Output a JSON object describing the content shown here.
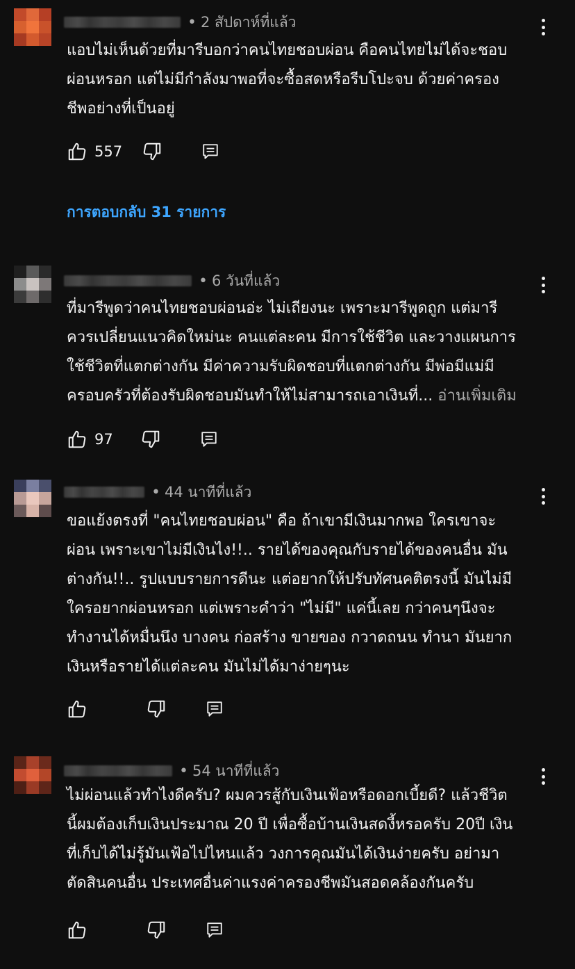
{
  "comments": [
    {
      "time": "2 สัปดาห์ที่แล้ว",
      "text": "แอบไม่เห็นด้วยที่มารีบอกว่าคนไทยชอบผ่อน คือคนไทยไม่ได้จะชอบ\nผ่อนหรอก แต่ไม่มีกำลังมาพอที่จะซื้อสดหรือรีบโปะจบ ด้วยค่าครอง\nชีพอย่างที่เป็นอยู่",
      "likes": "557",
      "read_more": "",
      "replies_label": "การตอบกลับ 31 รายการ",
      "avatar_colors": [
        "#c24a2a",
        "#e0683a",
        "#b53f25",
        "#d7602f",
        "#f0743c",
        "#c9522b",
        "#a63a22",
        "#d35a2e",
        "#b84427"
      ]
    },
    {
      "time": "6 วันที่แล้ว",
      "text": "ที่มารีพูดว่าคนไทยชอบผ่อนอ่ะ ไม่เถียงนะ เพราะมารีพูดถูก แต่มารี\nควรเปลี่ยนแนวคิดใหม่นะ คนแต่ละคน มีการใช้ชีวิต และวางแผนการ\nใช้ชีวิตที่แตกต่างกัน มีค่าความรับผิดชอบที่แตกต่างกัน มีพ่อมีแม่มี\nครอบครัวที่ต้องรับผิดชอบมันทำให้ไม่สามารถเอาเงินที่... ",
      "likes": "97",
      "read_more": "อ่านเพิ่มเติม",
      "replies_label": "",
      "avatar_colors": [
        "#1f1f1f",
        "#5a5a5a",
        "#2a2a2a",
        "#8c8c8c",
        "#c9c2c0",
        "#7d7878",
        "#3b3b3b",
        "#6e6a6a",
        "#2e2e2e"
      ]
    },
    {
      "time": "44 นาทีที่แล้ว",
      "text": "ขอแย้งตรงที่ \"คนไทยชอบผ่อน\" คือ ถ้าเขามีเงินมากพอ ใครเขาจะ\nผ่อน เพราะเขาไม่มีเงินไง!!.. รายได้ของคุณกับรายได้ของคนอื่น มัน\nต่างกัน!!.. รูปแบบรายการดีนะ แต่อยากให้ปรับทัศนคติตรงนี้ มันไม่มี\nใครอยากผ่อนหรอก แต่เพราะคำว่า \"ไม่มี\" แค่นี้เลย กว่าคนๆนึงจะ\nทำงานได้หมื่นนึง บางคน ก่อสร้าง ขายของ กวาดถนน ทำนา มันยาก\nเงินหรือรายได้แต่ละคน มันไม่ได้มาง่ายๆนะ",
      "likes": "",
      "read_more": "",
      "replies_label": "",
      "avatar_colors": [
        "#3a3f5c",
        "#7a7fa0",
        "#4a4f6c",
        "#b89a95",
        "#e9c7bd",
        "#c7a59c",
        "#6b5a5a",
        "#d7b3a8",
        "#5e4c4c"
      ]
    },
    {
      "time": "54 นาทีที่แล้ว",
      "text": "ไม่ผ่อนแล้วทำไงดีครับ? ผมควรสู้กับเงินเฟ้อหรือดอกเบี้ยดี? แล้วชีวิต\nนี้ผมต้องเก็บเงินประมาณ 20 ปี เพื่อซื้อบ้านเงินสดงี้หรอครับ 20ปี เงิน\nที่เก็บได้ไม่รู้มันเฟ้อไปไหนแล้ว วงการคุณมันได้เงินง่ายครับ อย่ามา\nตัดสินคนอื่น ประเทศอื่นค่าแรงค่าครองชีพมันสอดคล้องกันครับ",
      "likes": "",
      "read_more": "",
      "replies_label": "",
      "avatar_colors": [
        "#5a2418",
        "#a8412a",
        "#6b2a1c",
        "#c24c30",
        "#e0603c",
        "#b34628",
        "#4e1f15",
        "#9a3a25",
        "#5e2519"
      ]
    }
  ]
}
